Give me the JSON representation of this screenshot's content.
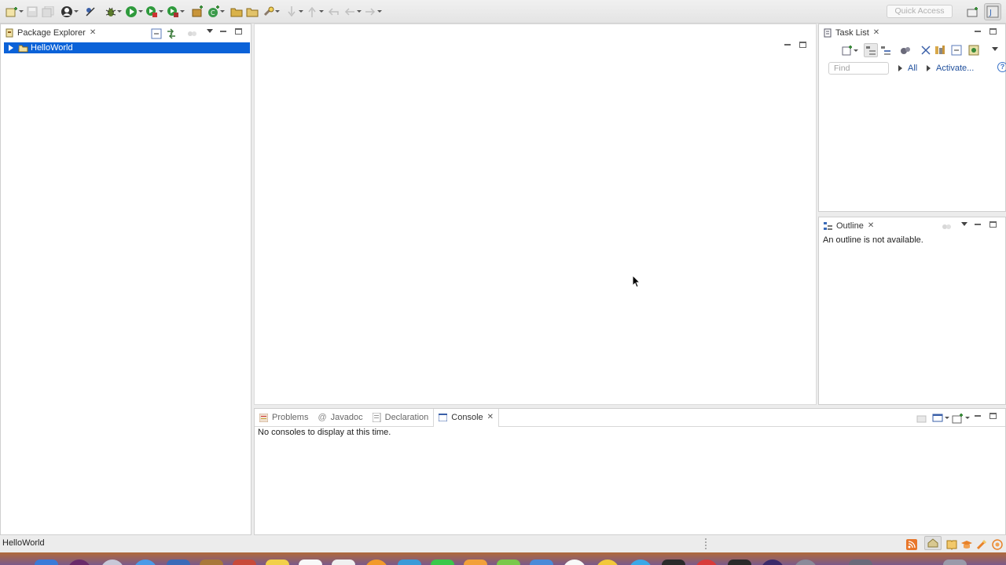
{
  "toolbar": {
    "quick_access_placeholder": "Quick Access",
    "icons": [
      "new-icon",
      "save-icon",
      "save-all-icon",
      "profile-icon",
      "skip-breakpoints-icon",
      "debug-icon",
      "run-icon",
      "coverage-icon",
      "external-tools-icon",
      "new-java-package-icon",
      "new-java-class-icon",
      "open-type-icon",
      "open-task-icon",
      "search-icon",
      "next-annotation-icon",
      "previous-annotation-icon",
      "back-icon",
      "forward-icon",
      "open-perspective-icon",
      "java-perspective-icon"
    ]
  },
  "package_explorer": {
    "tab_label": "Package Explorer",
    "tree": [
      {
        "label": "HelloWorld",
        "selected": true,
        "expanded": false
      }
    ]
  },
  "task_list": {
    "tab_label": "Task List",
    "find_placeholder": "Find",
    "filter_all": "All",
    "activate_label": "Activate..."
  },
  "outline": {
    "tab_label": "Outline",
    "message": "An outline is not available."
  },
  "bottom_panel": {
    "tabs": [
      {
        "label": "Problems",
        "active": false
      },
      {
        "label": "Javadoc",
        "active": false
      },
      {
        "label": "Declaration",
        "active": false
      },
      {
        "label": "Console",
        "active": true
      }
    ],
    "console_message": "No consoles to display at this time."
  },
  "status_bar": {
    "text": "HelloWorld"
  },
  "colors": {
    "selection": "#0b62d8",
    "link": "#1f4f9c",
    "panel_border": "#cfcfcf",
    "toolbar_bg": "#ececec"
  }
}
